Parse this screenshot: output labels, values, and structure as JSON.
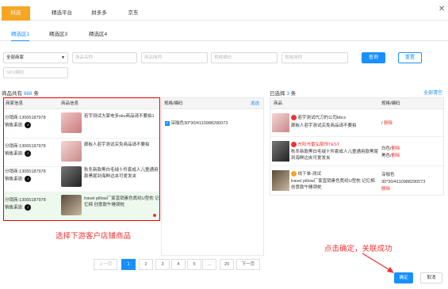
{
  "dialog": {
    "close_icon": "close-icon"
  },
  "top_tabs": [
    "抖店",
    "精选平台",
    "拼多多",
    "京东"
  ],
  "sub_tabs": [
    "精选区1",
    "精选区3",
    "精选区4"
  ],
  "filters": {
    "merchant_select": "全部商家",
    "product_name_placeholder": "商品名称",
    "product_short_placeholder": "商品简称",
    "spec_code_placeholder": "规格编码",
    "spec_short_placeholder": "规格简称",
    "sku_code_placeholder": "SKU编码",
    "query_label": "查询",
    "reset_label": "重置"
  },
  "left_panel": {
    "total_prefix": "商品共有",
    "total_count": "888",
    "total_suffix": "条",
    "col_shop": "商家信息",
    "col_product": "商品信息",
    "rows": [
      {
        "shop": "分销商:13065187978",
        "channel": "销售渠道:",
        "title": "若宇测试大家电多sku商品请不要拍1"
      },
      {
        "shop": "分销商:13065187978",
        "channel": "销售渠道:",
        "title": "廊板人若宇测试买免商品请不要拍"
      },
      {
        "shop": "分销商:13065187978",
        "channel": "销售渠道:",
        "title": "秋冬新款黑白毛绒十件套成人儿童通用款黑尾到海鲜边夹可爱发夹"
      },
      {
        "shop": "分销商:13065187978",
        "channel": "销售渠道:",
        "title": "travel pillow厂家直销素色氮纶U型枕 记忆棉 创意款午睡颈枕"
      }
    ]
  },
  "middle_panel": {
    "col_spec": "规格/编码",
    "select_label": "选选",
    "items": [
      {
        "checked": true,
        "label": "深咖色30*30/4110988290073"
      }
    ]
  },
  "right_panel": {
    "selected_prefix": "已选择",
    "selected_count": "3",
    "selected_suffix": "条",
    "clear_label": "全部清空",
    "col_product": "商品",
    "col_spec": "规格/编码",
    "rows": [
      {
        "shop": "若宇测试代刀的公司bbcc",
        "title": "廊板人若宇测试买免商品请不要拍",
        "spec": "/",
        "action": "删除"
      },
      {
        "shop": "东阳市雷弘服饰TEST",
        "title": "秋冬新款黑白毛绒十件套成人儿童通用款黑尾到海鲜边夹可爱发夹",
        "spec1": "白色/",
        "spec2": "黑色/",
        "action": "删除"
      },
      {
        "shop": "线下单-测试",
        "title": "travel pillow厂家直销素色氮纶U型枕 记忆棉 创意款午睡颈枕",
        "spec1": "深咖色",
        "spec2": "30*30/4110988290073",
        "action": "删除"
      }
    ]
  },
  "pagination": {
    "prev": "上一页",
    "pages": [
      "1",
      "2",
      "3",
      "4",
      "5",
      "...",
      "20"
    ],
    "next": "下一页",
    "active": "1"
  },
  "annotations": {
    "left_caption": "选择下游客户店铺商品",
    "right_caption": "点击确定，关联成功"
  },
  "footer": {
    "confirm": "确定",
    "cancel": "取消"
  },
  "colors": {
    "accent": "#1890ff",
    "tab_active": "#f5a623",
    "annotation": "#e33333"
  }
}
